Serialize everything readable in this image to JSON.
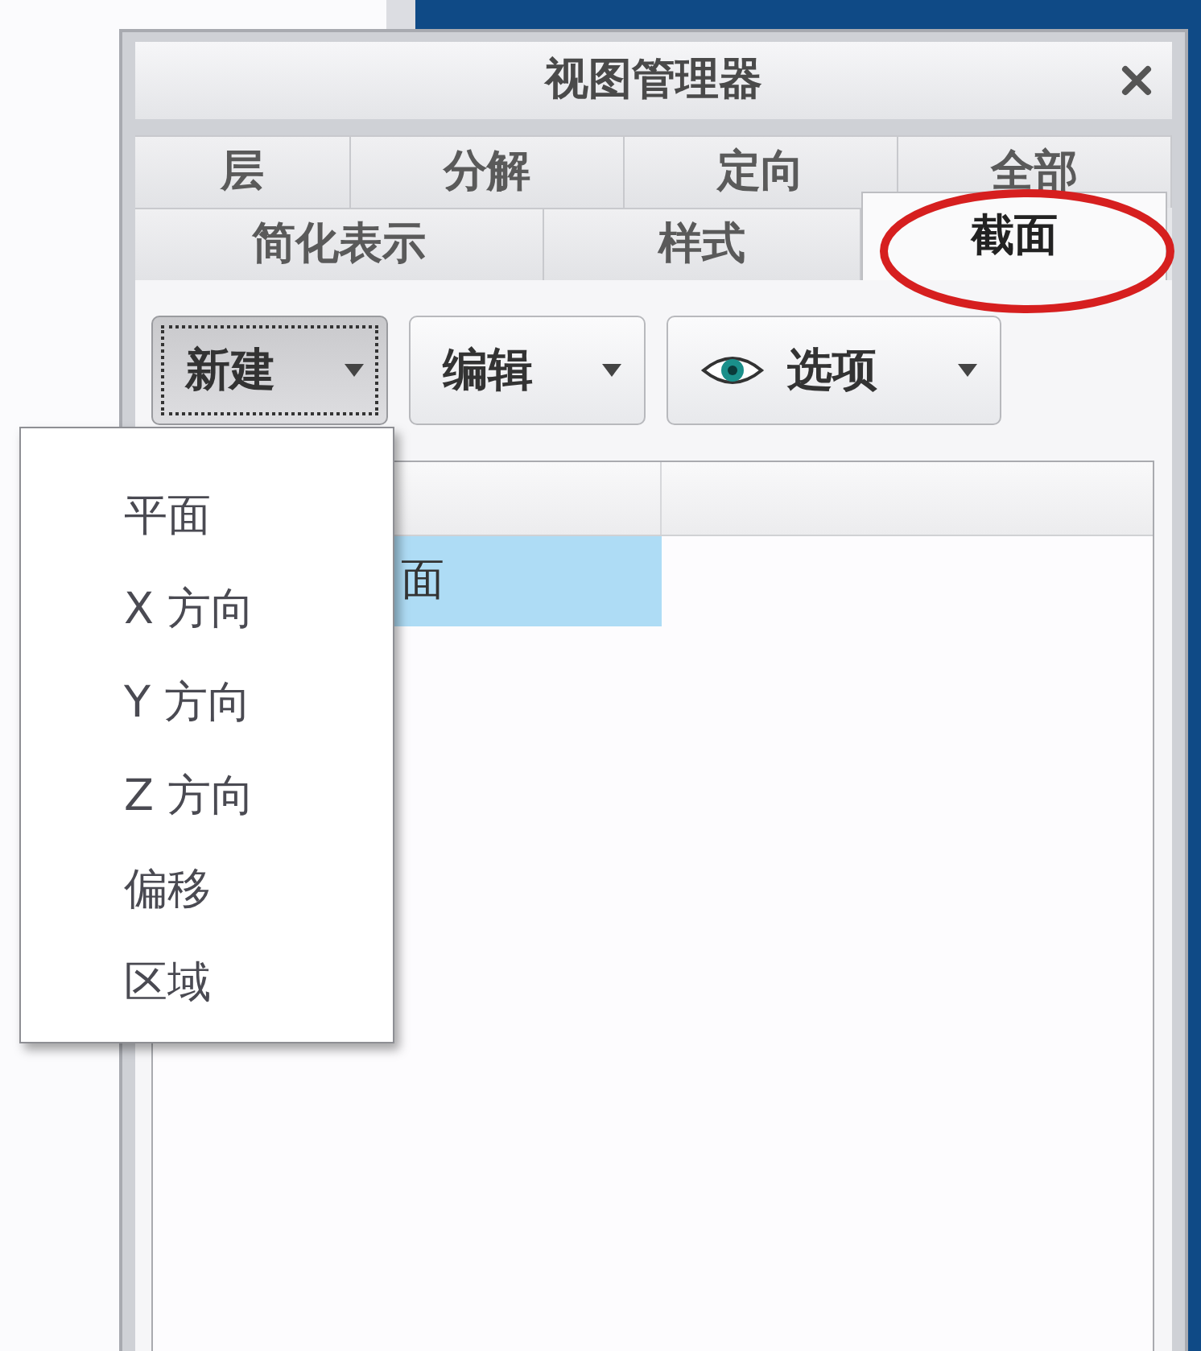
{
  "window": {
    "title": "视图管理器"
  },
  "tab_rows": [
    [
      {
        "label": "层",
        "selected": false
      },
      {
        "label": "分解",
        "selected": false
      },
      {
        "label": "定向",
        "selected": false
      },
      {
        "label": "全部",
        "selected": false
      }
    ],
    [
      {
        "label": "简化表示",
        "selected": false
      },
      {
        "label": "样式",
        "selected": false
      },
      {
        "label": "截面",
        "selected": true
      }
    ]
  ],
  "toolbar": [
    {
      "label": "新建",
      "kind": "plain",
      "pressed": true
    },
    {
      "label": "编辑",
      "kind": "plain",
      "pressed": false
    },
    {
      "label": "选项",
      "kind": "icon",
      "pressed": false
    }
  ],
  "list": {
    "rows": [
      {
        "text": "面",
        "selected": true
      }
    ]
  },
  "menu": {
    "items": [
      "平面",
      "X 方向",
      "Y 方向",
      "Z 方向",
      "偏移",
      "区域"
    ]
  }
}
